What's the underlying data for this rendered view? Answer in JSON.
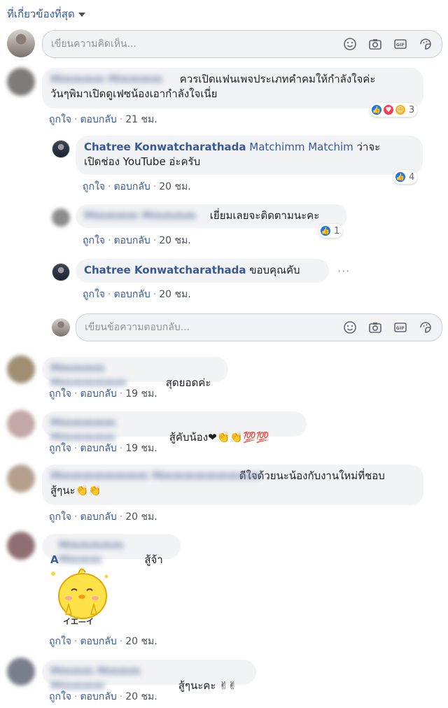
{
  "sort": {
    "label": "ที่เกี่ยวข้องที่สุด"
  },
  "composer": {
    "placeholder": "เขียนความคิดเห็น..."
  },
  "reply_composer": {
    "placeholder": "เขียนข้อความตอบกลับ..."
  },
  "actions": {
    "like": "ถูกใจ",
    "reply": "ตอบกลับ",
    "separator": "·"
  },
  "comments": [
    {
      "name": "Mmmmm Mmmmm",
      "text_line1": "ควรเปิดแฟนเพจประเภทคำคมให้กำลังใจค่ะ",
      "text_line2": "วันๆพิมาเปิดดูเฟซน้องเอากำลังใจเนี่ย",
      "time": "21 ชม.",
      "reaction_count": "3",
      "replies": [
        {
          "name": "Chatree Konwatcharathada",
          "mention": "Matchimm Matchim",
          "text_tail": "ว่าจะ",
          "text_line2": "เปิดช่อง YouTube อ่ะครับ",
          "time": "20 ชม.",
          "reaction_count": "4"
        },
        {
          "name": "Mmmmm Mmmmm",
          "text": "เยี่ยมเลยจะติดตามนะคะ",
          "time": "20 ชม.",
          "reaction_count": "1"
        },
        {
          "name": "Chatree Konwatcharathada",
          "text": "ขอบคุณคับ",
          "time": "20 ชม."
        }
      ]
    },
    {
      "name": "Mmmmm Mmmmmmm",
      "text": "สุดยอดค่ะ",
      "time": "19 ชม."
    },
    {
      "name": "Mmmmmm Mmmmmm",
      "text": "สู้คับน้อง❤👏👏💯💯",
      "time": "19 ชม."
    },
    {
      "name": "Mmmmmmmmm Mmmmmmmmmm",
      "text_line1": "ดีใจด้วยนะน้องกับงานใหม่ที่ชอบ",
      "text_line2": "สู้ๆนะ👏👏",
      "time": "20 ชม."
    },
    {
      "initial": "A",
      "name": "Mmmmmm Mmmm",
      "text": "สู้จ้า",
      "time": "20 ชม.",
      "sticker_text": "イエ—イ"
    },
    {
      "name": "Mmmm Mmmm Mmmmm",
      "text": "สู้ๆนะคะ ✌✌",
      "time": "20 ชม."
    }
  ],
  "icons": [
    "smile-icon",
    "camera-icon",
    "gif-icon",
    "sticker-icon",
    "like-reaction-icon",
    "love-reaction-icon",
    "haha-reaction-icon",
    "more-icon",
    "caret-down-icon"
  ],
  "colors": {
    "link": "#385898",
    "bubble": "#f2f3f5",
    "like": "#1877f2"
  }
}
